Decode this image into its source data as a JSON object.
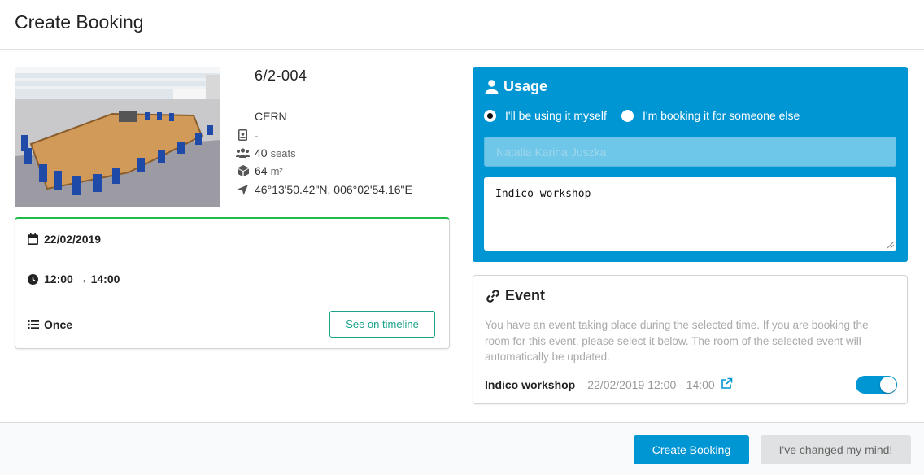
{
  "header": {
    "title": "Create Booking"
  },
  "room": {
    "name": "6/2-004",
    "site": "CERN",
    "owner_placeholder": "-",
    "capacity": "40",
    "capacity_unit": "seats",
    "surface": "64",
    "surface_unit": "m²",
    "location": "46°13'50.42\"N, 006°02'54.16\"E",
    "photo_icon": "conference-room-photo"
  },
  "booking": {
    "date": "22/02/2019",
    "time": "12:00 → 14:00",
    "recurrence": "Once",
    "timeline_button": "See on timeline"
  },
  "usage": {
    "title": "Usage",
    "options": [
      {
        "label": "I'll be using it myself",
        "selected": true
      },
      {
        "label": "I'm booking it for someone else",
        "selected": false
      }
    ],
    "user_value": "Natalia Karina Juszka",
    "reason_value": "Indico workshop",
    "accent_color": "#0095d3"
  },
  "event": {
    "title": "Event",
    "description": "You have an event taking place during the selected time. If you are booking the room for this event, please select it below. The room of the selected event will automatically be updated.",
    "name": "Indico workshop",
    "datetime": "22/02/2019 12:00 - 14:00",
    "linked": true
  },
  "footer": {
    "create_button": "Create Booking",
    "cancel_button": "I've changed my mind!"
  }
}
